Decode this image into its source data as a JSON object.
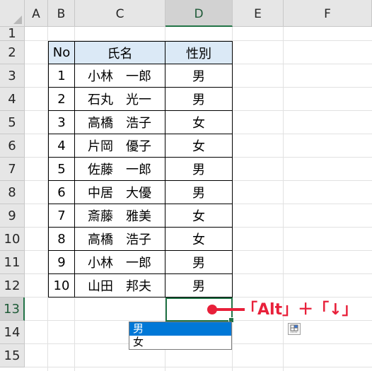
{
  "columns": [
    "A",
    "B",
    "C",
    "D",
    "E",
    "F"
  ],
  "selected_column": "D",
  "rows": [
    "1",
    "2",
    "3",
    "4",
    "5",
    "6",
    "7",
    "8",
    "9",
    "10",
    "11",
    "12",
    "13",
    "14",
    "15"
  ],
  "selected_row": "13",
  "table": {
    "headers": [
      "No",
      "氏名",
      "性別"
    ],
    "records": [
      {
        "no": "1",
        "name": "小林　一郎",
        "gender": "男"
      },
      {
        "no": "2",
        "name": "石丸　光一",
        "gender": "男"
      },
      {
        "no": "3",
        "name": "高橋　浩子",
        "gender": "女"
      },
      {
        "no": "4",
        "name": "片岡　優子",
        "gender": "女"
      },
      {
        "no": "5",
        "name": "佐藤　一郎",
        "gender": "男"
      },
      {
        "no": "6",
        "name": "中居　大優",
        "gender": "男"
      },
      {
        "no": "7",
        "name": "斎藤　雅美",
        "gender": "女"
      },
      {
        "no": "8",
        "name": "高橋　浩子",
        "gender": "女"
      },
      {
        "no": "9",
        "name": "小林　一郎",
        "gender": "男"
      },
      {
        "no": "10",
        "name": "山田　邦夫",
        "gender": "男"
      }
    ]
  },
  "dropdown": {
    "options": [
      "男",
      "女"
    ],
    "highlighted": "男"
  },
  "annotation": {
    "text": "「Alt」＋「↓」",
    "color": "#e8203a"
  },
  "colors": {
    "header_fill": "#dbe9f6",
    "selection_green": "#217346",
    "dropdown_highlight": "#0078d7"
  }
}
